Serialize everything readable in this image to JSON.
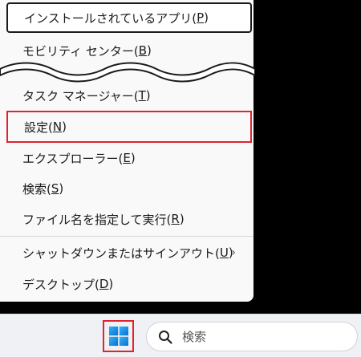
{
  "menu": {
    "items": [
      {
        "label": "インストールされているアプリ(",
        "key": "P",
        "tail": ")"
      },
      {
        "label": "モビリティ センター(",
        "key": "B",
        "tail": ")"
      },
      {
        "label": "タスク マネージャー(",
        "key": "T",
        "tail": ")"
      },
      {
        "label": "設定(",
        "key": "N",
        "tail": ")"
      },
      {
        "label": "エクスプローラー(",
        "key": "E",
        "tail": ")"
      },
      {
        "label": "検索(",
        "key": "S",
        "tail": ")"
      },
      {
        "label": "ファイル名を指定して実行(",
        "key": "R",
        "tail": ")"
      },
      {
        "label": "シャットダウンまたはサインアウト(",
        "key": "U",
        "tail": ")"
      },
      {
        "label": "デスクトップ(",
        "key": "D",
        "tail": ")"
      }
    ],
    "submenu_arrow": "›"
  },
  "taskbar": {
    "search_placeholder": "検索"
  },
  "colors": {
    "highlight_red": "#e0232f",
    "windows_blue": "#1a8be0"
  },
  "icons": {
    "start": "windows-logo-icon",
    "search": "magnifier-icon",
    "submenu": "chevron-right-icon"
  }
}
